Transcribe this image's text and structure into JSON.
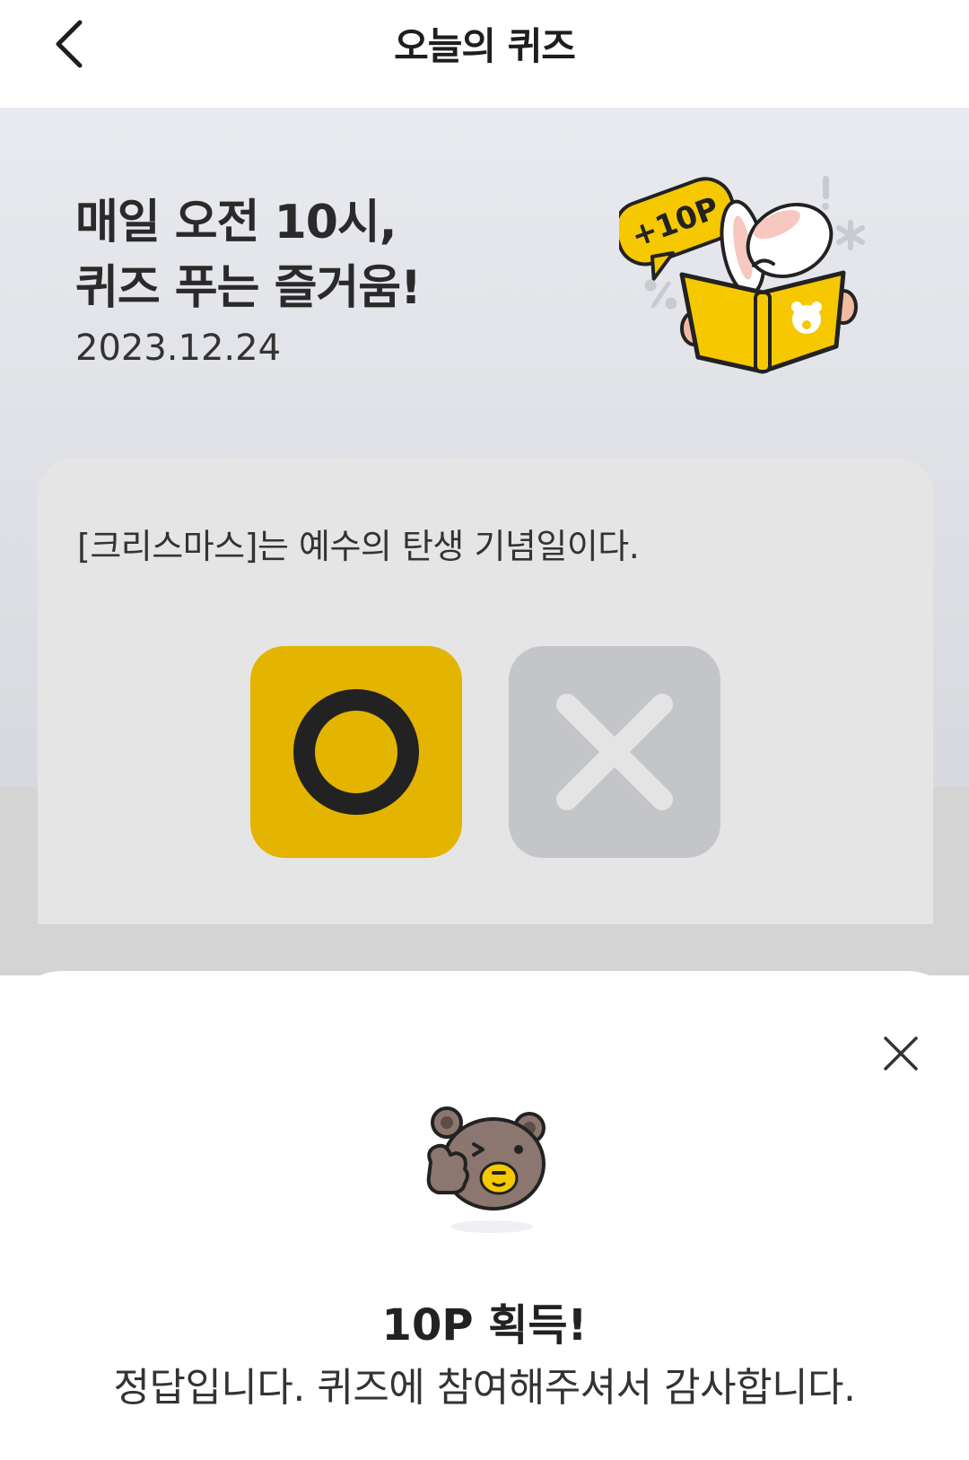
{
  "header": {
    "title": "오늘의 퀴즈"
  },
  "promo": {
    "line1": "매일 오전 10시,",
    "line2": "퀴즈 푸는 즐거움!",
    "date": "2023.12.24",
    "badge": "+10P"
  },
  "quiz": {
    "question": "[크리스마스]는 예수의 탄생 기념일이다.",
    "selected": "O"
  },
  "result": {
    "title": "10P 획득!",
    "message": "정답입니다. 퀴즈에 참여해주셔서 감사합니다."
  },
  "colors": {
    "accent": "#e3b400",
    "muted_button": "#c4c5c8",
    "mascot_bear": "#8b7670"
  }
}
